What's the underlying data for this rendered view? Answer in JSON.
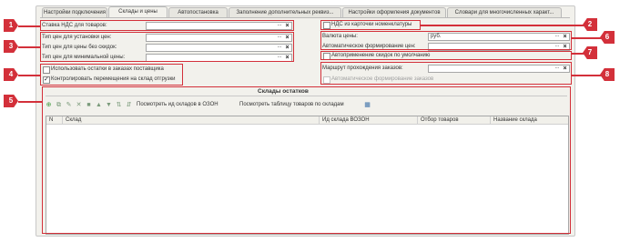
{
  "tabs": [
    "Настройки подключения",
    "Склады и цены",
    "Автопостановка",
    "Заполнение дополнительных реквиз...",
    "Настройки оформления документов",
    "Словари для многочисленных характ..."
  ],
  "active_tab": 1,
  "left": {
    "vat_rate_label": "Ставка НДС для товаров:",
    "price_type_label": "Тип цен для установки цен:",
    "price_nodiscount_label": "Тип цен для цены без скидок:",
    "price_min_label": "Тип цен для минимальной цены:",
    "use_supplier_stock": "Использовать остатки в заказах поставщика",
    "control_transfer": "Контролировать перемещения на склад отгрузки",
    "use_supplier_stock_checked": false,
    "control_transfer_checked": true
  },
  "right": {
    "vat_from_card": "НДС из карточки номенклатуры",
    "vat_from_card_checked": false,
    "currency_label": "Валюта цены:",
    "currency_value": "руб.",
    "auto_price_label": "Автоматическое формирование цен:",
    "auto_discount": "Автоприменение скидок по умолчанию",
    "auto_discount_checked": false,
    "route_label": "Маршрут прохождения заказов:",
    "auto_orders": "Автоматическое формирование заказов"
  },
  "warehouses": {
    "title": "Склады остатков",
    "btn_ozon_ids": "Посмотреть ид складов в ОЗОН",
    "btn_table": "Посмотреть таблицу товаров по складам",
    "columns": [
      "N",
      "Склад",
      "Ид склада ВОЗОН",
      "Отбор товаров",
      "Название склада"
    ]
  },
  "icons": [
    "add-icon",
    "copy-icon",
    "edit-icon",
    "delete-icon",
    "stop-icon",
    "up-icon",
    "down-icon",
    "sort-asc-icon",
    "sort-desc-icon",
    "table-icon"
  ],
  "badges": [
    "1",
    "2",
    "3",
    "4",
    "5",
    "6",
    "7",
    "8"
  ],
  "colors": {
    "highlight": "#d3303a",
    "panel": "#f2f1ec"
  },
  "field_buttons": {
    "choose": "...",
    "clear": "×"
  }
}
